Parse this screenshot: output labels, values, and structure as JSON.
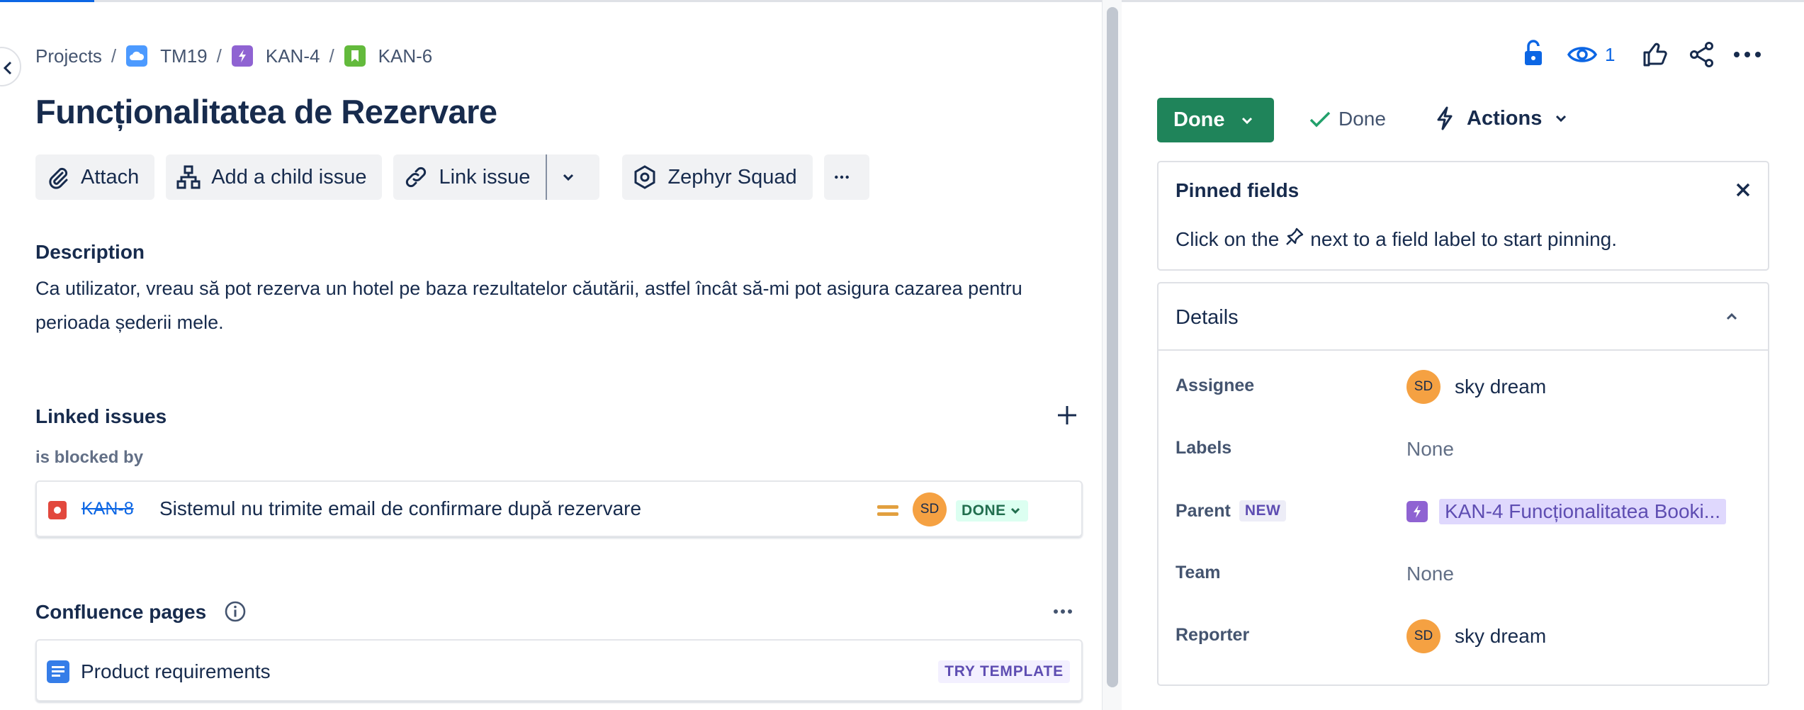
{
  "breadcrumb": {
    "projects": "Projects",
    "project": "TM19",
    "epic": "KAN-4",
    "issue": "KAN-6",
    "separator": "/"
  },
  "issue": {
    "title": "Funcționalitatea de Rezervare"
  },
  "toolbar": {
    "attach": "Attach",
    "add_child": "Add a child issue",
    "link_issue": "Link issue",
    "zephyr": "Zephyr Squad"
  },
  "description": {
    "heading": "Description",
    "text": "Ca utilizator, vreau să pot rezerva un hotel pe baza rezultatelor căutării, astfel încât să-mi pot asigura cazarea pentru perioada șederii mele."
  },
  "linked_issues": {
    "heading": "Linked issues",
    "relation": "is blocked by",
    "items": [
      {
        "key": "KAN-8",
        "summary": "Sistemul nu trimite email de confirmare după rezervare",
        "assignee_initials": "SD",
        "status": "DONE",
        "priority": "medium-priority-icon"
      }
    ]
  },
  "confluence": {
    "heading": "Confluence pages",
    "items": [
      {
        "title": "Product requirements",
        "badge": "TRY TEMPLATE"
      }
    ]
  },
  "side": {
    "watchers": "1",
    "status_button": "Done",
    "resolution": "Done",
    "actions": "Actions",
    "pinned": {
      "title": "Pinned fields",
      "text_before": "Click on the",
      "text_after": "next to a field label to start pinning."
    },
    "details": {
      "title": "Details",
      "fields": {
        "assignee_label": "Assignee",
        "assignee_initials": "SD",
        "assignee_name": "sky dream",
        "labels_label": "Labels",
        "labels_value": "None",
        "parent_label": "Parent",
        "parent_badge": "NEW",
        "parent_value": "KAN-4 Funcționalitatea Booki...",
        "team_label": "Team",
        "team_value": "None",
        "reporter_label": "Reporter",
        "reporter_initials": "SD",
        "reporter_name": "sky dream"
      }
    }
  },
  "colors": {
    "accent": "#0c66e4",
    "status_done": "#1f845a",
    "avatar": "#f5a142",
    "epic": "#8f63d2",
    "bug": "#e2483d",
    "story": "#63ba3c"
  }
}
